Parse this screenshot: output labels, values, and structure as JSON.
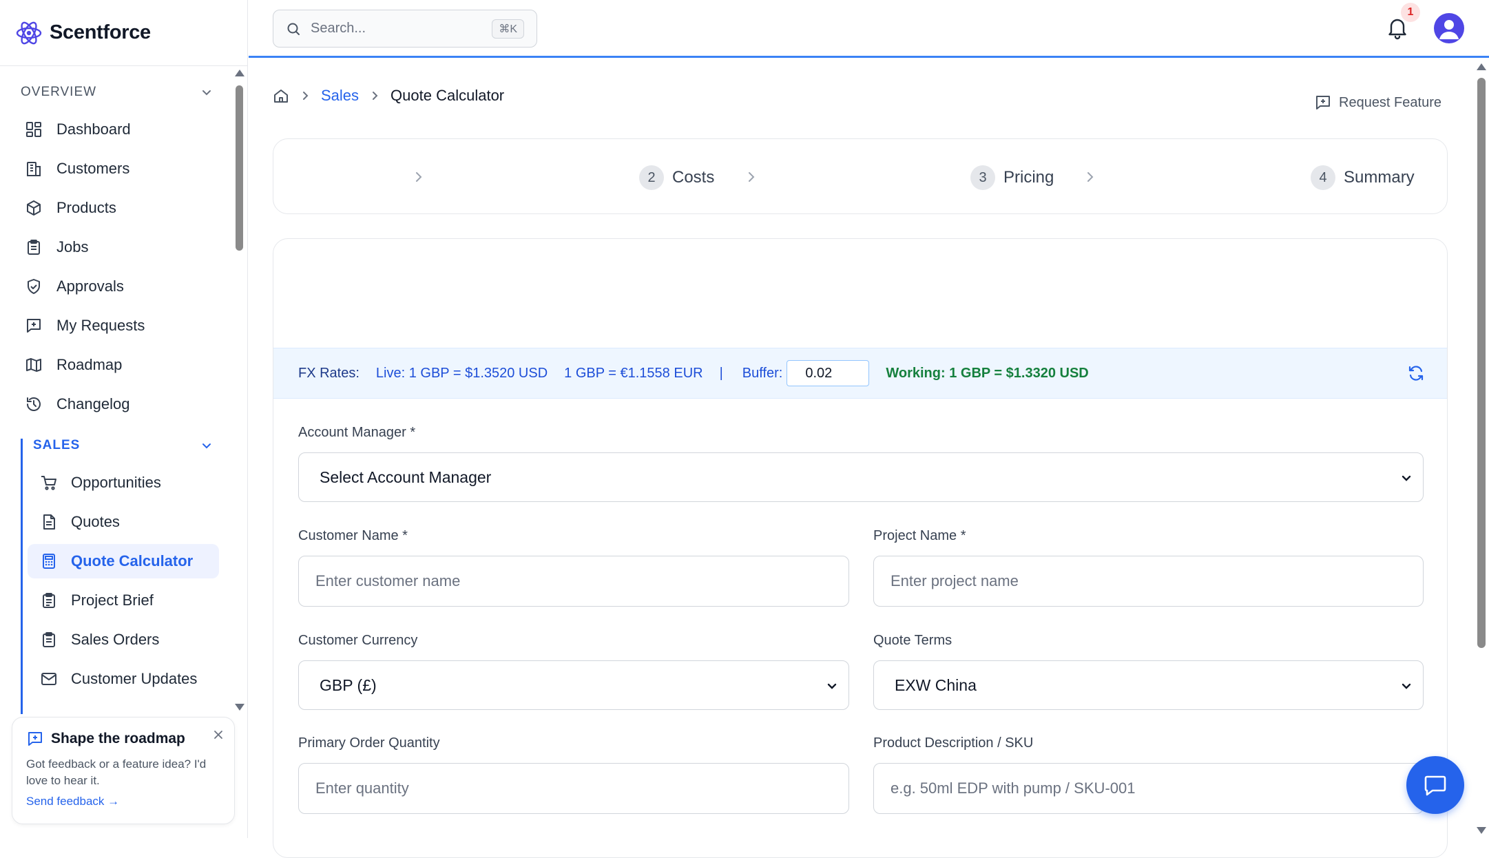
{
  "app": {
    "name": "Scentforce"
  },
  "topbar": {
    "search_placeholder": "Search...",
    "shortcut": "⌘K",
    "notification_count": "1"
  },
  "sidebar": {
    "overview_title": "OVERVIEW",
    "overview_items": [
      {
        "label": "Dashboard",
        "icon": "dashboard-icon"
      },
      {
        "label": "Customers",
        "icon": "building-icon"
      },
      {
        "label": "Products",
        "icon": "box-icon"
      },
      {
        "label": "Jobs",
        "icon": "clipboard-icon"
      },
      {
        "label": "Approvals",
        "icon": "shield-check-icon"
      },
      {
        "label": "My Requests",
        "icon": "message-plus-icon"
      },
      {
        "label": "Roadmap",
        "icon": "map-icon"
      },
      {
        "label": "Changelog",
        "icon": "history-icon"
      }
    ],
    "sales_title": "SALES",
    "sales_items": [
      {
        "label": "Opportunities",
        "icon": "cart-icon"
      },
      {
        "label": "Quotes",
        "icon": "file-text-icon"
      },
      {
        "label": "Quote Calculator",
        "icon": "calculator-icon",
        "active": true
      },
      {
        "label": "Project Brief",
        "icon": "clipboard-list-icon"
      },
      {
        "label": "Sales Orders",
        "icon": "clipboard-check-icon"
      },
      {
        "label": "Customer Updates",
        "icon": "mail-icon"
      }
    ],
    "feedback": {
      "title": "Shape the roadmap",
      "body": "Got feedback or a feature idea? I'd love to hear it.",
      "link": "Send feedback →"
    }
  },
  "breadcrumb": {
    "section": "Sales",
    "current": "Quote Calculator"
  },
  "request_feature": "Request Feature",
  "stepper": [
    {
      "num": "2",
      "label": "Costs"
    },
    {
      "num": "3",
      "label": "Pricing"
    },
    {
      "num": "4",
      "label": "Summary"
    }
  ],
  "fx": {
    "label": "FX Rates:",
    "live_usd": "Live: 1 GBP = $1.3520 USD",
    "live_eur": "1 GBP = €1.1558 EUR",
    "separator": "|",
    "buffer_label": "Buffer:",
    "buffer_value": "0.02",
    "working": "Working: 1 GBP = $1.3320 USD"
  },
  "form": {
    "account_manager": {
      "label": "Account Manager *",
      "value": "Select Account Manager"
    },
    "customer_name": {
      "label": "Customer Name *",
      "placeholder": "Enter customer name"
    },
    "project_name": {
      "label": "Project Name *",
      "placeholder": "Enter project name"
    },
    "customer_currency": {
      "label": "Customer Currency",
      "value": "GBP (£)"
    },
    "quote_terms": {
      "label": "Quote Terms",
      "value": "EXW China"
    },
    "primary_qty": {
      "label": "Primary Order Quantity",
      "placeholder": "Enter quantity"
    },
    "product_desc": {
      "label": "Product Description / SKU",
      "placeholder": "e.g. 50ml EDP with pump / SKU-001"
    }
  },
  "colors": {
    "primary": "#2563eb",
    "working_green": "#15803d",
    "fx_bg": "#eef6ff"
  }
}
